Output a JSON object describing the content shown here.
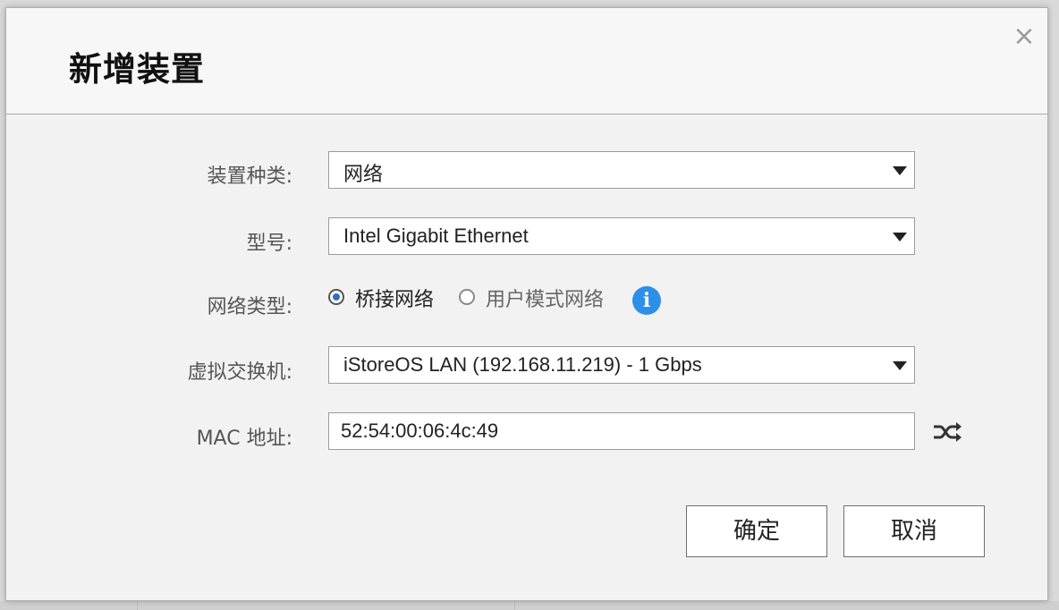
{
  "dialog": {
    "title": "新增装置",
    "close_symbol": "×"
  },
  "form": {
    "device_type": {
      "label": "装置种类:",
      "value": "网络"
    },
    "model": {
      "label": "型号:",
      "value": "Intel Gigabit Ethernet"
    },
    "network_type": {
      "label": "网络类型:",
      "options": [
        {
          "label": "桥接网络",
          "checked": true
        },
        {
          "label": "用户模式网络",
          "checked": false
        }
      ],
      "info_symbol": "i"
    },
    "virtual_switch": {
      "label": "虚拟交换机:",
      "value": "iStoreOS LAN (192.168.11.219) - 1 Gbps"
    },
    "mac_address": {
      "label": "MAC 地址:",
      "value": "52:54:00:06:4c:49"
    }
  },
  "buttons": {
    "ok": "确定",
    "cancel": "取消"
  },
  "icons": {
    "close": "close-icon",
    "dropdown": "caret-down-icon",
    "info": "info-icon",
    "random": "shuffle-icon"
  },
  "colors": {
    "info_blue": "#2d8fe8",
    "radio_selected": "#2f6fc4"
  }
}
